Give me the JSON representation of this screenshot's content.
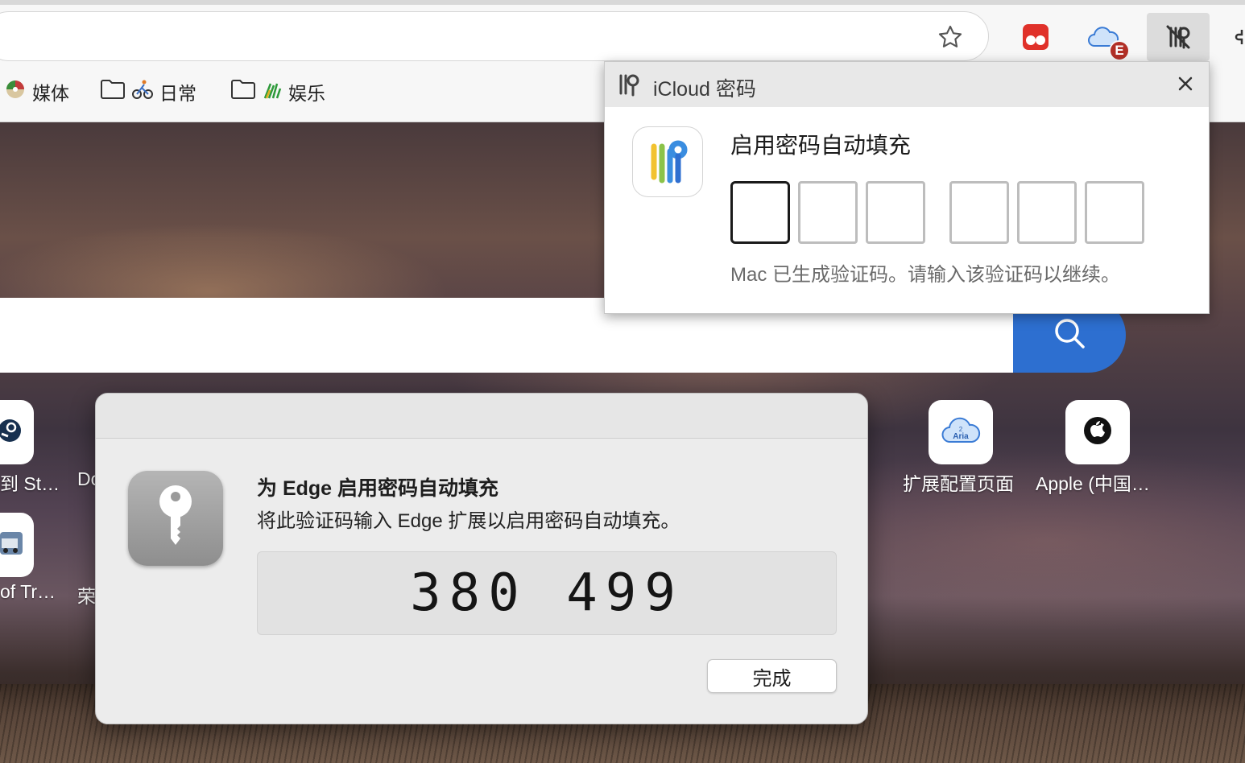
{
  "browser": {
    "bookmarks": [
      {
        "label": "媒体",
        "icon": "media-disc-icon"
      },
      {
        "label": "日常",
        "icon": "folder-icon"
      },
      {
        "label": "娱乐",
        "icon": "folder-icon"
      }
    ],
    "extensions": {
      "badge_label": "E"
    }
  },
  "tiles": [
    {
      "label": "到 St…"
    },
    {
      "label": "Do"
    },
    {
      "label": "of Tr…"
    },
    {
      "label": "荣"
    },
    {
      "label": "扩展配置页面",
      "icon_text_top": "2",
      "icon_text": "Aria"
    },
    {
      "label": "Apple (中国…"
    }
  ],
  "icloud_popup": {
    "title": "iCloud 密码",
    "heading": "启用密码自动填充",
    "hint": "Mac 已生成验证码。请输入该验证码以继续。",
    "code_slots": 6
  },
  "dialog": {
    "title": "为 Edge 启用密码自动填充",
    "description": "将此验证码输入 Edge 扩展以启用密码自动填充。",
    "code": "380 499",
    "done_label": "完成"
  },
  "colors": {
    "search_button": "#2d6fd0",
    "badge": "#b22f26"
  }
}
